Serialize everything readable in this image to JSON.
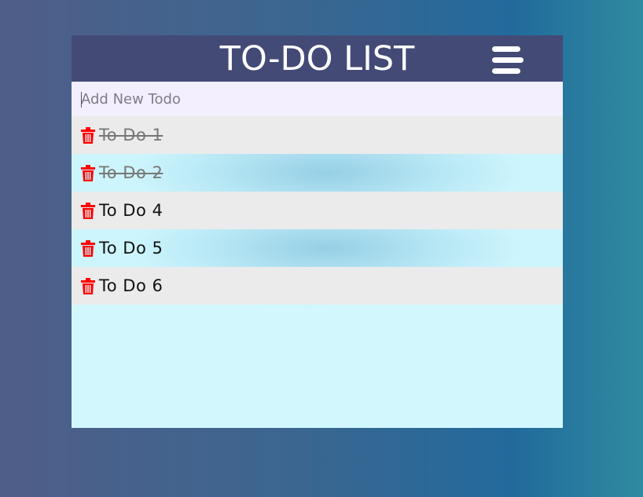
{
  "header": {
    "title": "TO-DO LIST",
    "menu_icon": "hamburger-menu-icon"
  },
  "input": {
    "placeholder": "Add New Todo",
    "value": ""
  },
  "todos": [
    {
      "text": "To Do 1",
      "completed": true
    },
    {
      "text": "To Do 2",
      "completed": true
    },
    {
      "text": "To Do 4",
      "completed": false
    },
    {
      "text": "To Do 5",
      "completed": false
    },
    {
      "text": "To Do 6",
      "completed": false
    }
  ],
  "colors": {
    "header_bg": "#434a76",
    "delete_icon": "#ff0000",
    "input_bg": "#f4efff",
    "row_gray": "#ebebeb"
  },
  "icons": {
    "delete": "trash-icon"
  }
}
